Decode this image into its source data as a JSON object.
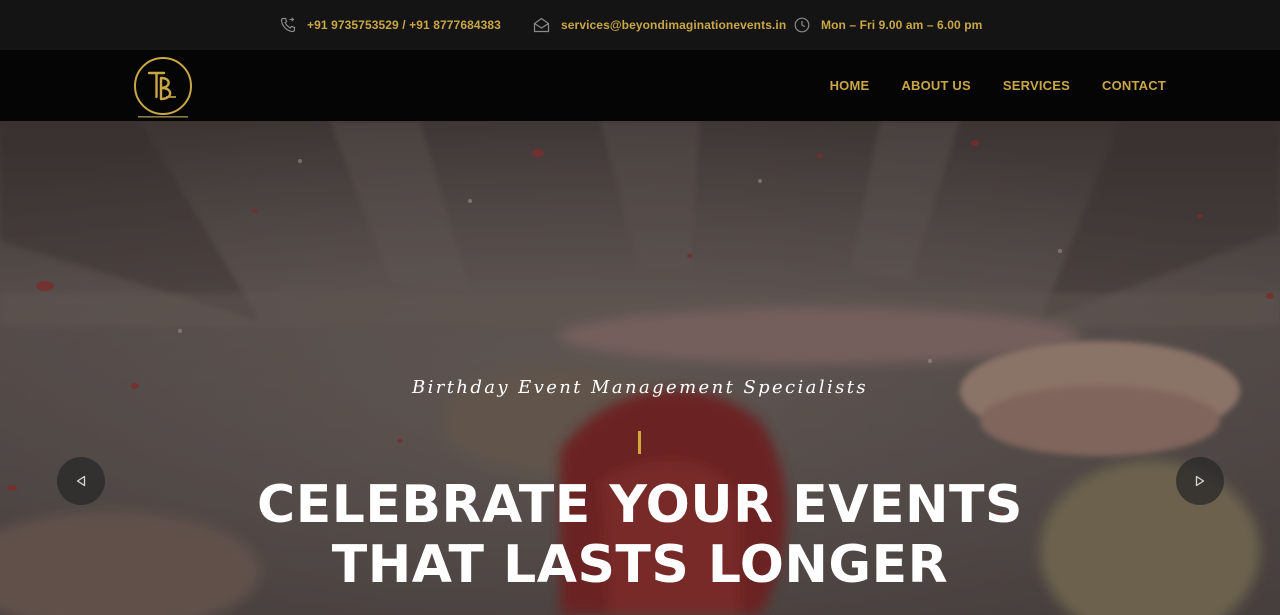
{
  "topbar": {
    "phone": "+91 9735753529  / +91 8777684383",
    "email": "services@beyondimaginationevents.in",
    "hours": "Mon – Fri 9.00 am – 6.00 pm",
    "icons": [
      "phone-icon",
      "mail-icon",
      "clock-icon"
    ]
  },
  "nav": {
    "items": [
      {
        "label": "HOME"
      },
      {
        "label": "ABOUT US"
      },
      {
        "label": "SERVICES"
      },
      {
        "label": "CONTACT"
      }
    ]
  },
  "hero": {
    "subtitle": "Birthday Event Management Specialists",
    "title_line1": "CELEBRATE YOUR EVENTS",
    "title_line2": "THAT LASTS LONGER",
    "prev_icon": "chevron-left-icon",
    "next_icon": "chevron-right-icon"
  },
  "colors": {
    "accent": "#c9a646",
    "topbar_bg": "#141414",
    "nav_bg": "#050505",
    "divider": "#d4a83a"
  }
}
